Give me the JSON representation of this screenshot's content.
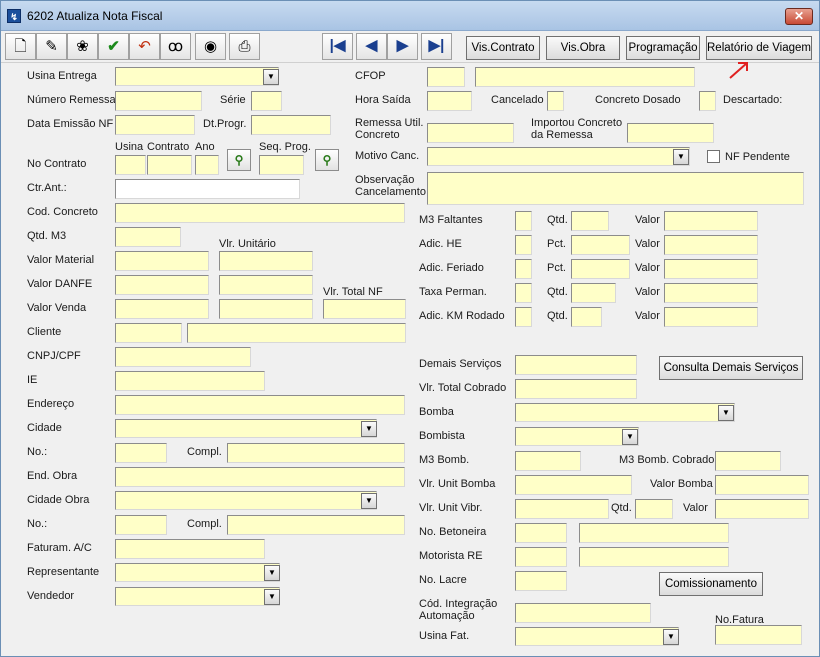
{
  "window": {
    "title": "6202 Atualiza Nota Fiscal",
    "app_icon": "app-icon",
    "close_glyph": "✕"
  },
  "toolbar": {
    "icons": [
      "new-document-icon",
      "print-preview-icon",
      "popcorn-icon",
      "checkmark-icon",
      "undo-icon",
      "binoculars-icon",
      "record-icon",
      "printer-icon"
    ],
    "nav": [
      "first-record-icon",
      "previous-record-icon",
      "next-record-icon",
      "last-record-icon"
    ],
    "nav_glyphs": [
      "|◀",
      "◀",
      "▶",
      "▶|"
    ],
    "buttons": {
      "vis_contrato": "Vis.Contrato",
      "vis_obra": "Vis.Obra",
      "programacao": "Programação",
      "relatorio_viagem": "Relatório de Viagem"
    }
  },
  "left": {
    "usina_entrega": "Usina Entrega",
    "numero_remessa": "Número Remessa",
    "serie": "Série",
    "data_emissao_nf": "Data Emissão NF",
    "dt_progr": "Dt.Progr.",
    "usina": "Usina",
    "contrato": "Contrato",
    "ano": "Ano",
    "seq_prog": "Seq. Prog.",
    "no_contrato": "No Contrato",
    "ctr_ant": "Ctr.Ant.:",
    "cod_concreto": "Cod. Concreto",
    "qtd_m3": "Qtd. M3",
    "vlr_unitario": "Vlr. Unitário",
    "valor_material": "Valor Material",
    "valor_danfe": "Valor DANFE",
    "vlr_total_nf": "Vlr. Total NF",
    "valor_venda": "Valor Venda",
    "cliente": "Cliente",
    "cnpj_cpf": "CNPJ/CPF",
    "ie": "IE",
    "endereco": "Endereço",
    "cidade": "Cidade",
    "no": "No.:",
    "compl": "Compl.",
    "end_obra": "End. Obra",
    "cidade_obra": "Cidade Obra",
    "no2": "No.:",
    "compl2": "Compl.",
    "faturam_ac": "Faturam. A/C",
    "representante": "Representante",
    "vendedor": "Vendedor"
  },
  "right": {
    "cfop": "CFOP",
    "hora_saida": "Hora Saída",
    "cancelado": "Cancelado",
    "concreto_dosado": "Concreto Dosado",
    "descartado": "Descartado:",
    "remessa_util_concreto_1": "Remessa Util.",
    "remessa_util_concreto_2": "Concreto",
    "importou_concreto_1": "Importou Concreto",
    "importou_concreto_2": "da Remessa",
    "motivo_canc": "Motivo Canc.",
    "nf_pendente": "NF Pendente",
    "observacao_1": "Observação",
    "observacao_2": "Cancelamento",
    "m3_faltantes": "M3 Faltantes",
    "adic_he": "Adic. HE",
    "adic_feriado": "Adic. Feriado",
    "taxa_perman": "Taxa Perman.",
    "adic_km_rodado": "Adic. KM Rodado",
    "qtd": "Qtd.",
    "pct": "Pct.",
    "valor": "Valor",
    "demais_servicos": "Demais Serviços",
    "consulta_demais_servicos": "Consulta Demais Serviços",
    "vlr_total_cobrado": "Vlr. Total Cobrado",
    "bomba": "Bomba",
    "bombista": "Bombista",
    "m3_bomb": "M3 Bomb.",
    "m3_bomb_cobrado": "M3 Bomb. Cobrado",
    "vlr_unit_bomba": "Vlr. Unit Bomba",
    "valor_bomba": "Valor Bomba",
    "vlr_unit_vibr": "Vlr. Unit Vibr.",
    "no_betoneira": "No. Betoneira",
    "motorista_re": "Motorista   RE",
    "no_lacre": "No. Lacre",
    "comissionamento": "Comissionamento",
    "cod_integracao_1": "Cód. Integração",
    "cod_integracao_2": "Automação",
    "no_fatura": "No.Fatura",
    "usina_fat": "Usina Fat."
  },
  "glyphs": {
    "dropdown": "▼",
    "lookup": "⚲"
  },
  "colors": {
    "field_bg": "#ffffc8",
    "accent_arrow": "#e02020",
    "nav_blue": "#1a3f8f"
  }
}
